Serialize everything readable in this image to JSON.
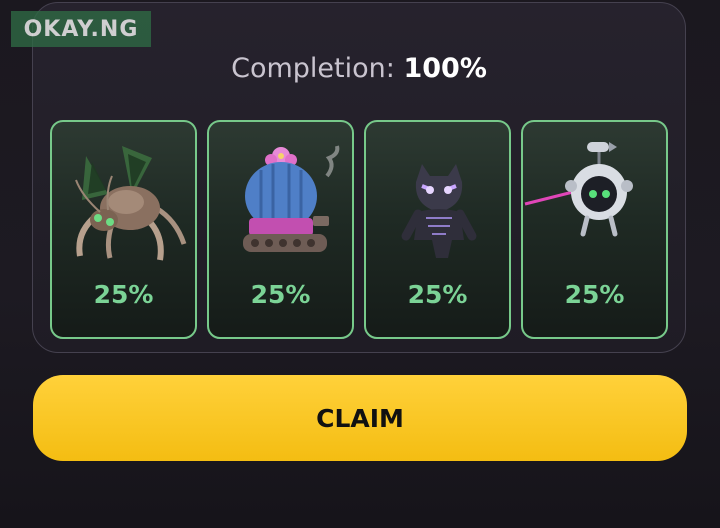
{
  "watermark": "OKAY.NG",
  "completion": {
    "label": "Completion:",
    "value": "100%"
  },
  "cards": [
    {
      "icon": "spider-robot-icon",
      "percent": "25%"
    },
    {
      "icon": "cactus-tank-icon",
      "percent": "25%"
    },
    {
      "icon": "panther-hero-icon",
      "percent": "25%"
    },
    {
      "icon": "drone-robot-icon",
      "percent": "25%"
    }
  ],
  "claim_button": {
    "label": "CLAIM"
  },
  "colors": {
    "accent_yellow": "#f7c21b",
    "card_border_green": "#77c98a",
    "percent_green": "#7bd396",
    "background": "#1b181f"
  }
}
